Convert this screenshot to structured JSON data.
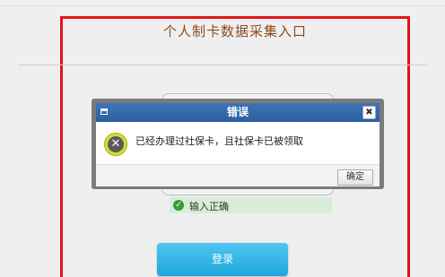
{
  "page": {
    "title": "个人制卡数据采集入口",
    "validation_message": "输入正确",
    "login_label": "登录"
  },
  "dialog": {
    "title": "错误",
    "message": "已经办理过社保卡，且社保卡已被领取",
    "confirm_label": "确定",
    "close_glyph": "✖",
    "icon": "error-x-icon"
  },
  "colors": {
    "frame_border": "#e0141a",
    "title_text": "#8a4b1b",
    "dialog_titlebar": "#2b5f9f",
    "login_button": "#1ea7dc",
    "success_bg": "#d9ecd9"
  }
}
